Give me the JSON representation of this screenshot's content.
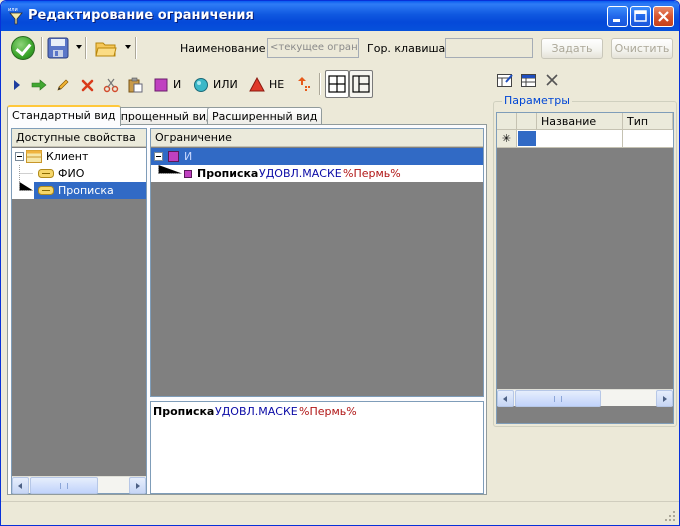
{
  "window": {
    "title": "Редактирование ограничения",
    "icon_caption": "или"
  },
  "toolbar_top": {
    "name_label": "Наименование",
    "name_value": "<текущее ограни",
    "hotkey_label": "Гор. клавиша",
    "hotkey_value": "",
    "set_label": "Задать",
    "clear_label": "Очистить"
  },
  "toolbar_ops": {
    "and_label": "И",
    "or_label": "ИЛИ",
    "not_label": "НЕ"
  },
  "tabs": [
    {
      "label": "Стандартный вид",
      "active": true
    },
    {
      "label": "Упрощенный вид",
      "active": false
    },
    {
      "label": "Расширенный вид",
      "active": false
    }
  ],
  "properties": {
    "header": "Доступные свойства",
    "items": [
      {
        "label": "Клиент"
      },
      {
        "label": "ФИО"
      },
      {
        "label": "Прописка"
      }
    ]
  },
  "restriction": {
    "header": "Ограничение",
    "root_label": "И",
    "clause": {
      "field": "Прописка",
      "operator": "УДОВЛ.МАСКЕ",
      "value": "%Пермь%"
    }
  },
  "preview": {
    "field": "Прописка",
    "operator": "УДОВЛ.МАСКЕ",
    "value": "%Пермь%"
  },
  "parameters": {
    "title": "Параметры",
    "columns": [
      "Название",
      "Тип"
    ],
    "new_row_marker": "✳"
  },
  "colors": {
    "title_bar": "#0A5CF0",
    "selection": "#316AC5",
    "keyword": "#0A0AA6",
    "value": "#B01515",
    "and_square": "#C040C0"
  }
}
